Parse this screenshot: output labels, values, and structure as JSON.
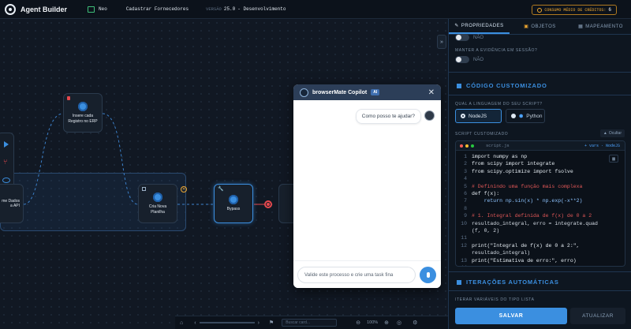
{
  "topbar": {
    "app_title": "Agent Builder",
    "project_badge": "Neo",
    "flow_name": "Cadastrar Fornecedores",
    "version_label": "VERSÃO",
    "version_value": "25.0",
    "version_state": "- Desenvolvimento",
    "credits_label": "CONSUMO MÉDIO DE CRÉDITOS:",
    "credits_value": "6"
  },
  "canvas": {
    "nodes": [
      {
        "label": "Insere cada Registro no ERP"
      },
      {
        "label": "Cria Nova Planilha"
      },
      {
        "label": "Bypass"
      },
      {
        "label_line1": "me Dados",
        "label_line2": "a API"
      }
    ]
  },
  "chat": {
    "title": "browserMate Copilot",
    "badge": "AI",
    "message": "Como posso te ajudar?",
    "input_placeholder": "Valide este processo e crie uma task fina"
  },
  "panel": {
    "tabs": [
      "PROPRIEDADES",
      "OBJETOS",
      "MAPEAMENTO"
    ],
    "toggle1_label": "NÃO",
    "evidence_label": "MANTER A EVIDÊNCIA EM SESSÃO?",
    "toggle2_label": "NÃO",
    "section_code": "CÓDIGO CUSTOMIZADO",
    "language_question": "QUAL A LINGUAGEM DO SEU SCRIPT?",
    "lang_nodejs": "NodeJS",
    "lang_python": "Python",
    "script_label": "SCRIPT CUSTOMIZADO",
    "hide_label": "Ocultar",
    "file_name": "script.js",
    "vars_label": "+ vars · NodeJS",
    "code_lines": [
      {
        "n": "1",
        "t": "import numpy as np"
      },
      {
        "n": "2",
        "t": "from scipy import integrate"
      },
      {
        "n": "3",
        "t": "from scipy.optimize import fsolve"
      },
      {
        "n": "4",
        "t": ""
      },
      {
        "n": "5",
        "t": "# Definindo uma função mais complexa"
      },
      {
        "n": "6",
        "t": "def f(x):"
      },
      {
        "n": "7",
        "t": "    return np.sin(x) * np.exp(-x**2)"
      },
      {
        "n": "8",
        "t": ""
      },
      {
        "n": "9",
        "t": "# 1. Integral definida de f(x) de 0 a 2"
      },
      {
        "n": "10",
        "t": "resultado_integral, erro = integrate.quad"
      },
      {
        "n": "",
        "t": "(f, 0, 2)"
      },
      {
        "n": "11",
        "t": ""
      },
      {
        "n": "12",
        "t": "print(\"Integral de f(x) de 0 a 2:\","
      },
      {
        "n": "",
        "t": "resultado_integral)"
      },
      {
        "n": "13",
        "t": "print(\"Estimativa de erro:\", erro)"
      },
      {
        "n": "14",
        "t": ""
      }
    ],
    "section_iter": "ITERAÇÕES AUTOMÁTICAS",
    "iter_label": "ITERAR VARIÁVEIS DO TIPO LISTA",
    "save_button": "SALVAR",
    "update_button": "ATUALIZAR"
  },
  "bottombar": {
    "search_placeholder": "Buscar card...",
    "zoom": "100%"
  },
  "colors": {
    "accent": "#3b8fe0",
    "warning": "#f0a830",
    "danger": "#e5484d"
  }
}
